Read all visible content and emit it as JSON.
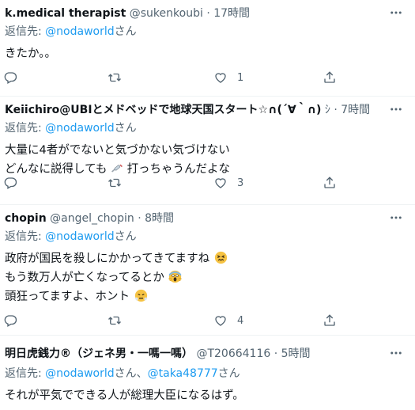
{
  "tweets": [
    {
      "name": "k.medical therapist",
      "handle": "@sukenkoubi",
      "dot": "·",
      "time": "17時間",
      "reply_prefix": "返信先: ",
      "mention": "@nodaworld",
      "reply_suffix": "さん",
      "lines": [
        "きたか。。"
      ],
      "likes": "1"
    },
    {
      "name": "Keiichiro@UBIとメドベッドで地球天国スタート☆∩(´∀｀∩)",
      "handle": "ｼ",
      "dot": "·",
      "time": "7時間",
      "reply_prefix": "返信先: ",
      "mention": "@nodaworld",
      "reply_suffix": "さん",
      "lines": [
        "大量に4者がでないと気づかない気づけない",
        "どんなに説得しても",
        "打っちゃうんだよな"
      ],
      "likes": "3"
    },
    {
      "name": "chopin",
      "handle": "@angel_chopin",
      "dot": "·",
      "time": "8時間",
      "reply_prefix": "返信先: ",
      "mention": "@nodaworld",
      "reply_suffix": "さん",
      "lines": [
        "政府が国民を殺しにかかってきてますね",
        "もう数万人が亡くなってるとか",
        "頭狂ってますよ、ホント"
      ],
      "likes": "4"
    },
    {
      "name": "明日虎銭力®（ジェネ男・一嗎一嗎）",
      "handle": "@T20664116",
      "dot": "·",
      "time": "5時間",
      "reply_prefix": "返信先: ",
      "mention": "@nodaworld",
      "reply_suffix": "さん、",
      "mention2": "@taka48777",
      "reply_suffix2": "さん",
      "lines": [
        "それが平気でできる人が総理大臣になるはず。"
      ]
    }
  ]
}
